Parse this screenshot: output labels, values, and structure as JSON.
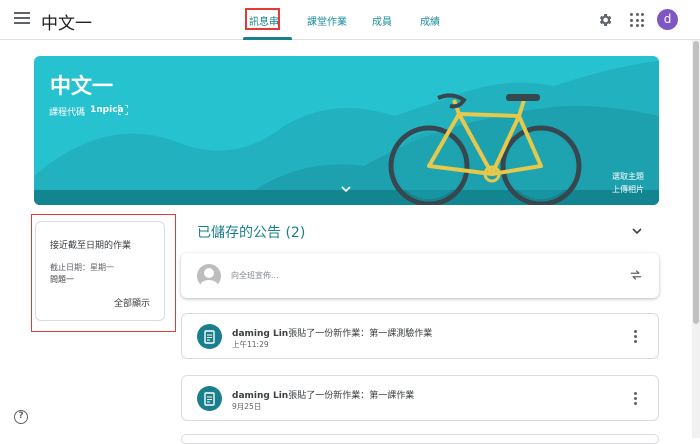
{
  "app": {
    "class_name": "中文一"
  },
  "tabs": [
    {
      "label": "訊息串",
      "active": true
    },
    {
      "label": "課堂作業"
    },
    {
      "label": "成員"
    },
    {
      "label": "成績"
    }
  ],
  "user": {
    "avatar_letter": "d",
    "avatar_color": "#7e57c2"
  },
  "icons": {
    "menu": "hamburger-menu-icon",
    "settings": "gear-icon",
    "apps": "apps-grid-icon",
    "help": "help-circle-icon"
  },
  "banner": {
    "title": "中文一",
    "code_label": "課程代碼",
    "code_value": "1npica",
    "select_theme": "選取主題",
    "upload_photo": "上傳相片",
    "color": "#26c2cf"
  },
  "upcoming": {
    "title": "接近截至日期的作業",
    "due": "截止日期：星期一",
    "item": "問題一",
    "view_all": "全部顯示"
  },
  "stream": {
    "saved_title": "已儲存的公告 (2)",
    "announce_placeholder": "向全班宣佈...",
    "items": [
      {
        "author": "daming Lin",
        "text": "張貼了一份新作業：第一課測驗作業",
        "time": "上午11:29"
      },
      {
        "author": "daming Lin",
        "text": "張貼了一份新作業：第一課作業",
        "time": "9月25日"
      }
    ]
  },
  "help_label": "?",
  "colors": {
    "accent": "#1a7f8c",
    "highlight_box": "#e53935"
  }
}
